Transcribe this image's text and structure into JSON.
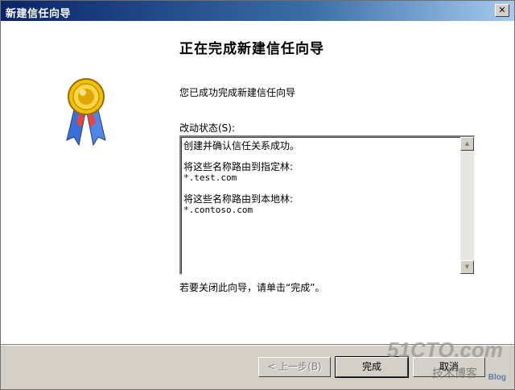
{
  "window": {
    "title": "新建信任向导",
    "close_glyph": "✕"
  },
  "page": {
    "heading": "正在完成新建信任向导",
    "description": "您已成功完成新建信任向导",
    "status_label": "改动状态(S):",
    "status_lines": [
      {
        "text": "创建并确认信任关系成功。",
        "kind": "cn"
      },
      {
        "text": "",
        "kind": "gap"
      },
      {
        "text": "将这些名称路由到指定林:",
        "kind": "cn"
      },
      {
        "text": "*.test.com",
        "kind": "mono"
      },
      {
        "text": "",
        "kind": "gap"
      },
      {
        "text": "将这些名称路由到本地林:",
        "kind": "cn"
      },
      {
        "text": "*.contoso.com",
        "kind": "mono"
      }
    ],
    "footer_note": "若要关闭此向导，请单击“完成”。"
  },
  "buttons": {
    "back": "< 上一步(B)",
    "finish": "完成",
    "cancel": "取消"
  },
  "icons": {
    "close": "close-icon",
    "badge": "award-ribbon-icon",
    "scroll_up": "scroll-up-arrow-icon",
    "scroll_down": "scroll-down-arrow-icon"
  },
  "watermark": {
    "line1": "51CTO.com",
    "line2": "技术博客",
    "line3": "Blog"
  },
  "colors": {
    "title_bar_start": "#0a246a",
    "title_bar_end": "#a6caf0",
    "dialog_face": "#d4d0c8",
    "badge_gold": "#e0a800",
    "ribbon_blue": "#3a6fd8"
  }
}
